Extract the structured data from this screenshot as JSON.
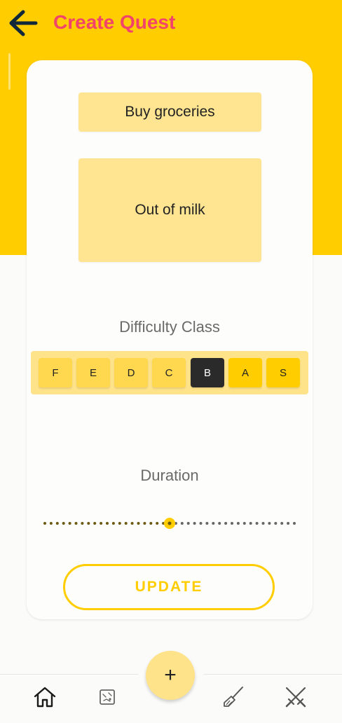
{
  "header": {
    "title": "Create Quest",
    "back_icon": "arrow-left-icon",
    "title_color": "#f2436a",
    "background": "#ffcd00"
  },
  "form": {
    "quest_title": "Buy groceries",
    "quest_description": "Out of milk",
    "difficulty_label": "Difficulty Class",
    "difficulty_options": [
      "F",
      "E",
      "D",
      "C",
      "B",
      "A",
      "S"
    ],
    "difficulty_selected": "B",
    "duration_label": "Duration",
    "duration_fraction": 0.5,
    "update_label": "UPDATE"
  },
  "bottom_nav": {
    "items": [
      "home-icon",
      "map-icon",
      "broom-icon",
      "crossed-swords-icon"
    ],
    "fab_label": "+"
  },
  "colors": {
    "accent": "#ffcd00",
    "field_bg": "#ffe591",
    "selected_bg": "#2a2a2a"
  }
}
